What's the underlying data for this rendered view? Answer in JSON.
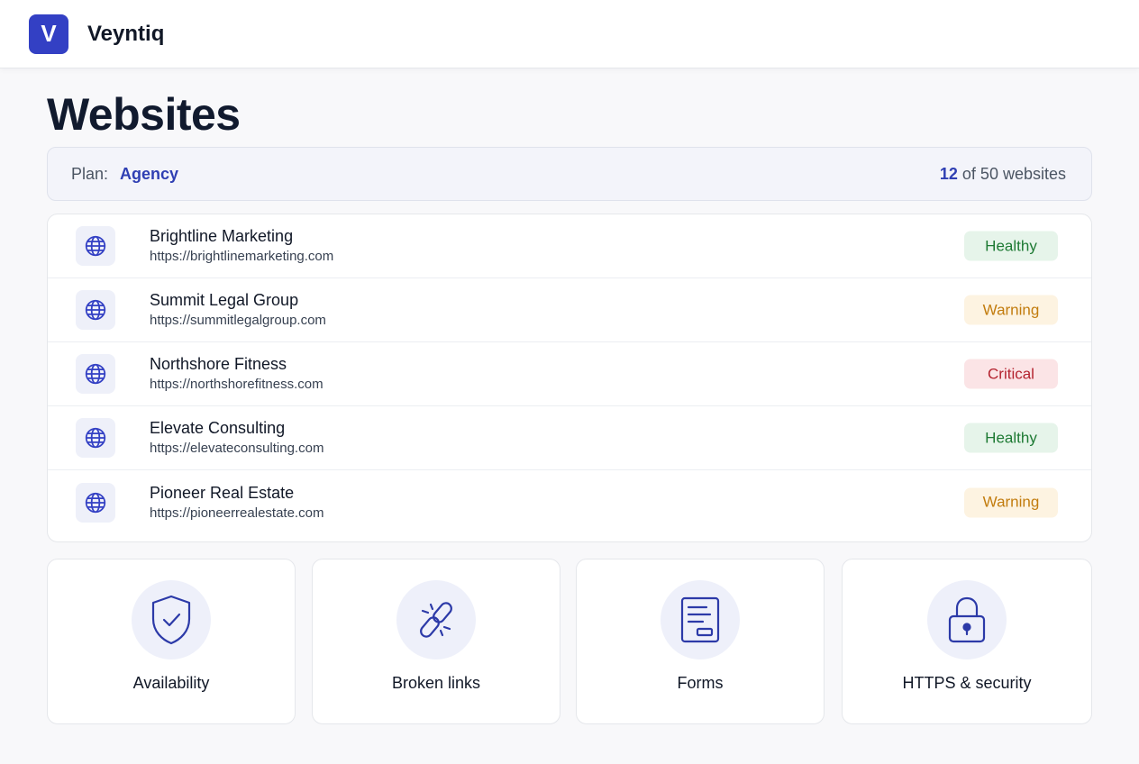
{
  "app": {
    "logo_letter": "V",
    "name": "Veyntiq"
  },
  "page": {
    "title": "Websites"
  },
  "plan": {
    "label": "Plan:",
    "name": "Agency",
    "used": "12",
    "usage_suffix": "of 50 websites"
  },
  "sites": [
    {
      "name": "Brightline Marketing",
      "url": "https://brightlinemarketing.com",
      "status": "Healthy"
    },
    {
      "name": "Summit Legal Group",
      "url": "https://summitlegalgroup.com",
      "status": "Warning"
    },
    {
      "name": "Northshore Fitness",
      "url": "https://northshorefitness.com",
      "status": "Critical"
    },
    {
      "name": "Elevate Consulting",
      "url": "https://elevateconsulting.com",
      "status": "Healthy"
    },
    {
      "name": "Pioneer Real Estate",
      "url": "https://pioneerrealestate.com",
      "status": "Warning"
    }
  ],
  "features": [
    {
      "label": "Availability",
      "icon": "shield-check-icon"
    },
    {
      "label": "Broken links",
      "icon": "broken-link-icon"
    },
    {
      "label": "Forms",
      "icon": "form-icon"
    },
    {
      "label": "HTTPS & security",
      "icon": "lock-icon"
    }
  ],
  "colors": {
    "accent": "#3340c4",
    "healthy": "#1e7a34",
    "warning": "#c27c0e",
    "critical": "#b4232f"
  }
}
